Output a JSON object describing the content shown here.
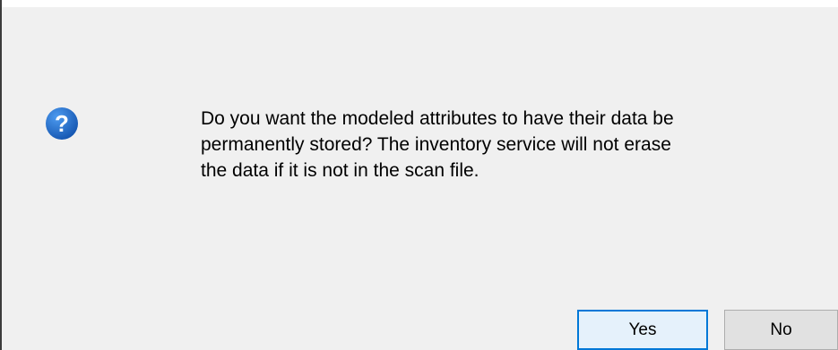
{
  "dialog": {
    "icon": "question-icon",
    "message": "Do you want the modeled attributes to have their data be\npermanently stored?  The inventory service will not erase\nthe data if it is not in the scan file.",
    "buttons": {
      "yes_label": "Yes",
      "no_label": "No"
    }
  },
  "colors": {
    "background": "#f0f0f0",
    "icon_blue": "#1e6dc9",
    "focus_border": "#0078d7"
  }
}
